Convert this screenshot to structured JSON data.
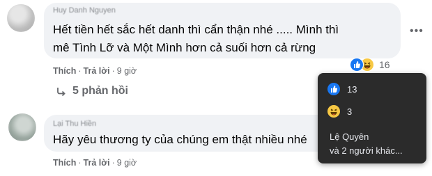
{
  "comments": [
    {
      "author": "Huy Danh Nguyen",
      "lines": [
        "Hết tiền hết sắc hết danh thì cẩn thận nhé ..... Mình thì",
        "mê Tình Lỡ và Một Mình hơn cả suối hơn cả rừng"
      ],
      "actions": {
        "like": "Thích",
        "reply": "Trả lời",
        "time": "9 giờ"
      },
      "reaction_count": "16",
      "replies_label": "5 phản hồi"
    },
    {
      "author": "Lại Thu Hiền",
      "lines": [
        "Hãy yêu thương ty của chúng em thật nhiều nhé"
      ],
      "actions": {
        "like": "Thích",
        "reply": "Trả lời",
        "time": "9 giờ"
      }
    }
  ],
  "tooltip": {
    "like_count": "13",
    "haha_count": "3",
    "names_line1": "Lệ Quyên",
    "names_line2": "và 2 người khác..."
  },
  "icons": {
    "more": "more-options-icon",
    "reply_arrow": "reply-arrow-icon",
    "like": "like-reaction-icon",
    "haha": "haha-reaction-icon"
  },
  "colors": {
    "like_blue": "#1877f2",
    "haha_yellow": "#f7c844",
    "bubble": "#f0f2f5",
    "tooltip_bg": "#2b2b2b"
  }
}
